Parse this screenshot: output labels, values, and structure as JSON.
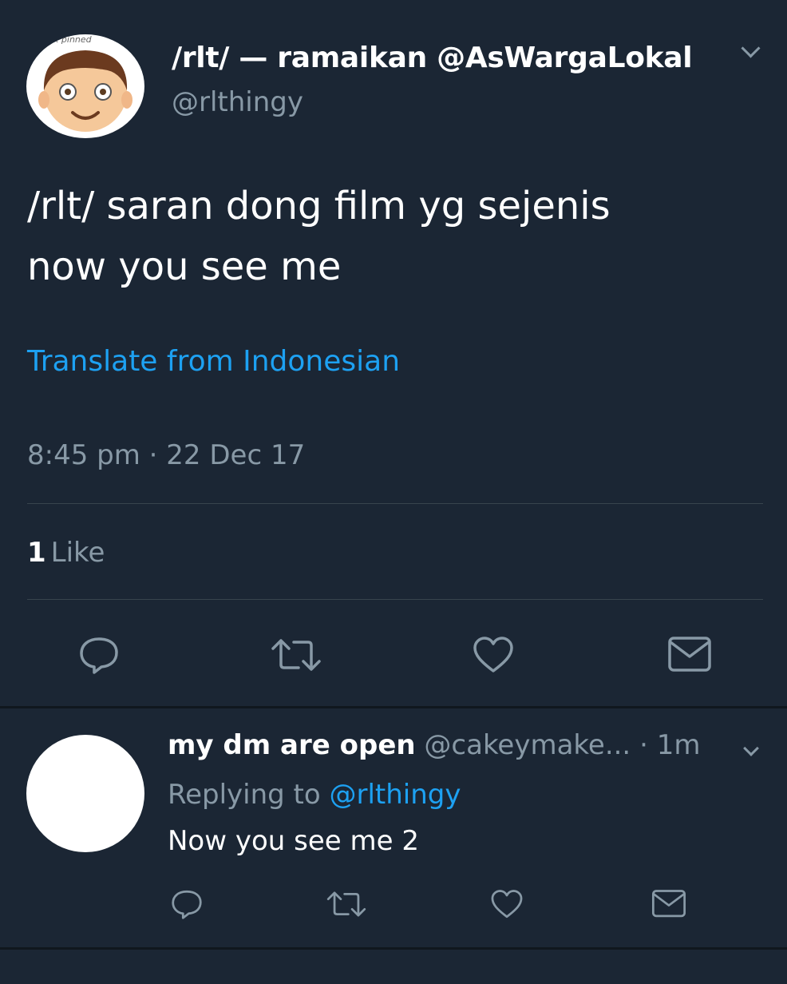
{
  "main_tweet": {
    "pinned_label": "ck pinned",
    "display_name": "/rlt/ — ramaikan @AsWargaLokal",
    "handle": "@rlthingy",
    "text_line1": "/rlt/ saran dong film yg sejenis",
    "text_line2": "now you see me",
    "translate": "Translate from Indonesian",
    "timestamp": "8:45 pm · 22 Dec 17",
    "likes_count": "1",
    "likes_label": "Like"
  },
  "reply": {
    "display_name": "my dm are open",
    "handle": "@cakeymake...",
    "dot": "·",
    "time": "1m",
    "replying_prefix": "Replying to",
    "replying_mention": "@rlthingy",
    "text": "Now you see me 2"
  },
  "colors": {
    "background": "#1b2634",
    "accent": "#1da1f2",
    "secondary_text": "#8899a6",
    "divider": "#38444d"
  },
  "icons": [
    "reply-icon",
    "retweet-icon",
    "like-icon",
    "message-icon",
    "chevron-down-icon"
  ]
}
